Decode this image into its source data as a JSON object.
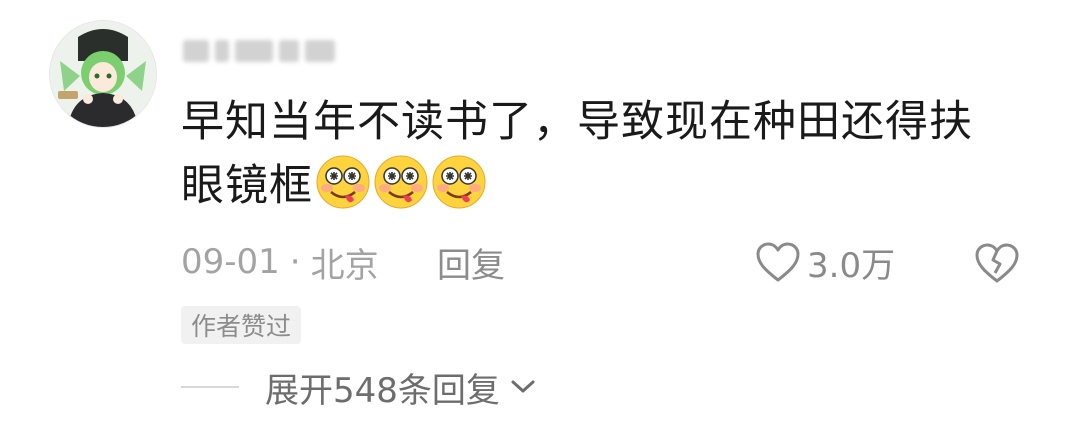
{
  "comment": {
    "text_line1": "早知当年不读书了，导致现在种田还得扶",
    "text_line2": "眼镜框",
    "emoji_icons": [
      "drunk-face-emoji",
      "drunk-face-emoji",
      "drunk-face-emoji"
    ],
    "date": "09-01",
    "location": "北京",
    "separator": "·",
    "reply_label": "回复",
    "like_count": "3.0万",
    "badge": "作者赞过",
    "expand_label": "展开548条回复"
  },
  "icons": {
    "like": "heart-outline-icon",
    "dislike": "broken-heart-icon",
    "expand": "chevron-down-icon"
  },
  "colors": {
    "text": "#1a1a1a",
    "meta": "#a3a3a3",
    "badge_bg": "#f1f1f1"
  }
}
